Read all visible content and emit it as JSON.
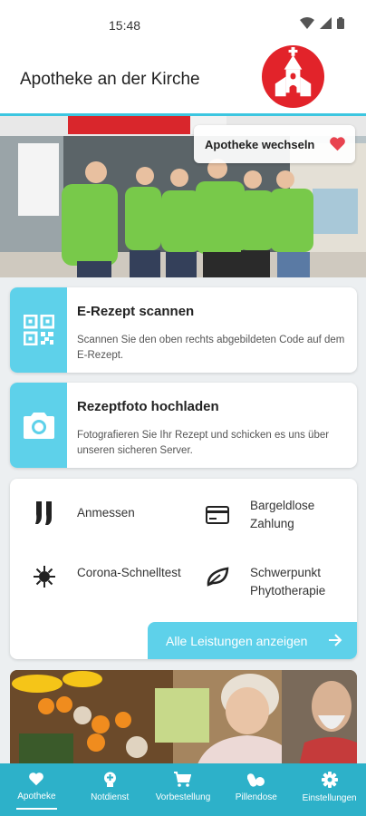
{
  "status": {
    "time": "15:48"
  },
  "header": {
    "title": "Apotheke an der Kirche"
  },
  "hero": {
    "switch_label": "Apotheke wechseln"
  },
  "actions": [
    {
      "title": "E-Rezept scannen",
      "desc": "Scannen Sie den oben rechts abgebildeten Code auf dem E-Rezept.",
      "icon": "qr-code-icon"
    },
    {
      "title": "Rezeptfoto hochladen",
      "desc": "Fotografieren Sie Ihr Rezept und schicken es uns über unseren sicheren Server.",
      "icon": "camera-icon"
    }
  ],
  "services": {
    "items": [
      {
        "label": "Anmessen",
        "icon": "stockings-icon"
      },
      {
        "label": "Bargeldlose Zahlung",
        "icon": "credit-card-icon"
      },
      {
        "label": "Corona-Schnelltest",
        "icon": "virus-icon"
      },
      {
        "label": "Schwerpunkt Phytotherapie",
        "icon": "leaf-icon"
      }
    ],
    "all_label": "Alle Leistungen anzeigen"
  },
  "nav": [
    {
      "label": "Apotheke",
      "icon": "heart-icon",
      "active": true
    },
    {
      "label": "Notdienst",
      "icon": "emergency-icon"
    },
    {
      "label": "Vorbestellung",
      "icon": "cart-icon"
    },
    {
      "label": "Pillendose",
      "icon": "pills-icon"
    },
    {
      "label": "Einstellungen",
      "icon": "gear-icon"
    }
  ],
  "colors": {
    "accent": "#5ed1ea",
    "nav_bg": "#2db1c9",
    "logo_red": "#e2232a",
    "heart": "#e8434f"
  }
}
